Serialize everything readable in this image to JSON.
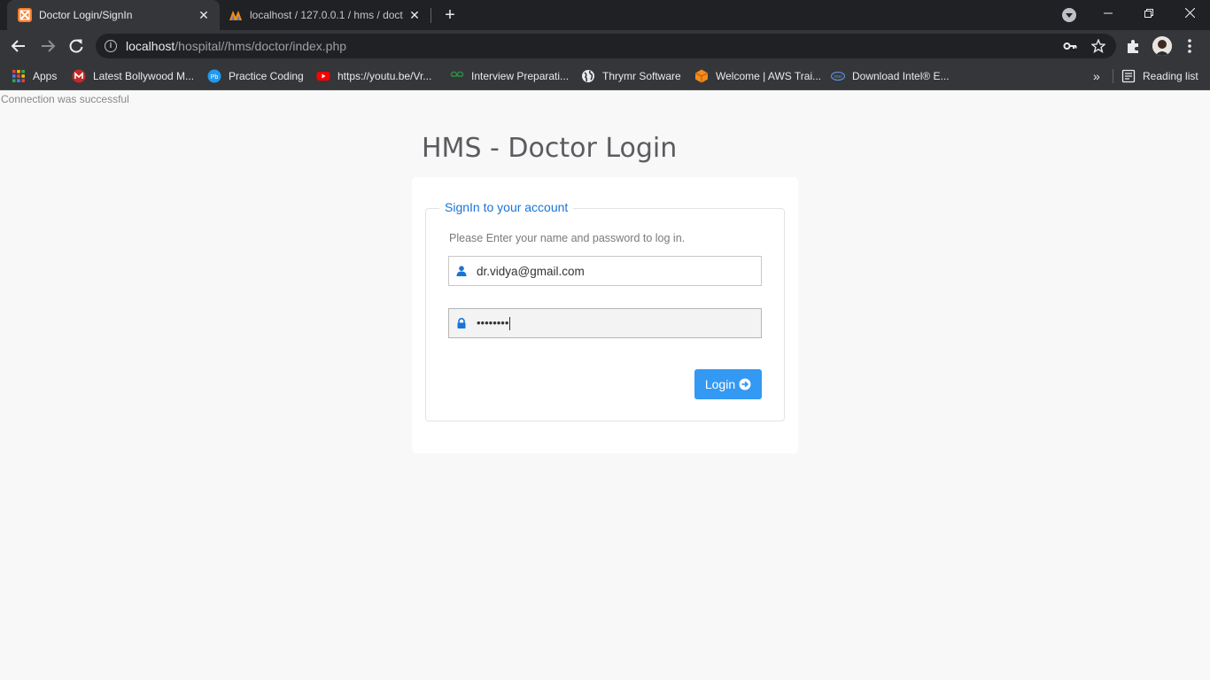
{
  "browser": {
    "tabs": [
      {
        "title": "Doctor Login/SignIn",
        "active": true,
        "favicon": "xampp-icon"
      },
      {
        "title": "localhost / 127.0.0.1 / hms / doct",
        "active": false,
        "favicon": "phpmyadmin-icon"
      }
    ],
    "url_host": "localhost",
    "url_path": "/hospital//hms/doctor/index.php",
    "bookmarks": [
      {
        "label": "Apps",
        "icon": "apps-grid-icon"
      },
      {
        "label": "Latest Bollywood M...",
        "icon": "bollywood-icon"
      },
      {
        "label": "Practice Coding",
        "icon": "practice-coding-icon"
      },
      {
        "label": "https://youtu.be/Vr...",
        "icon": "youtube-icon"
      },
      {
        "label": "Interview Preparati...",
        "icon": "gfg-icon"
      },
      {
        "label": "Thrymr Software",
        "icon": "globe-icon"
      },
      {
        "label": "Welcome | AWS Trai...",
        "icon": "aws-icon"
      },
      {
        "label": "Download Intel® E...",
        "icon": "intel-icon"
      }
    ],
    "reading_list": "Reading list"
  },
  "page": {
    "status": "Connection was successful",
    "title": "HMS - Doctor Login",
    "legend": "SignIn to your account",
    "hint": "Please Enter your name and password to log in.",
    "username_value": "dr.vidya@gmail.com",
    "password_mask": "••••••••",
    "login_label": "Login"
  },
  "colors": {
    "accent": "#3399f3",
    "legend": "#1a73d6"
  }
}
